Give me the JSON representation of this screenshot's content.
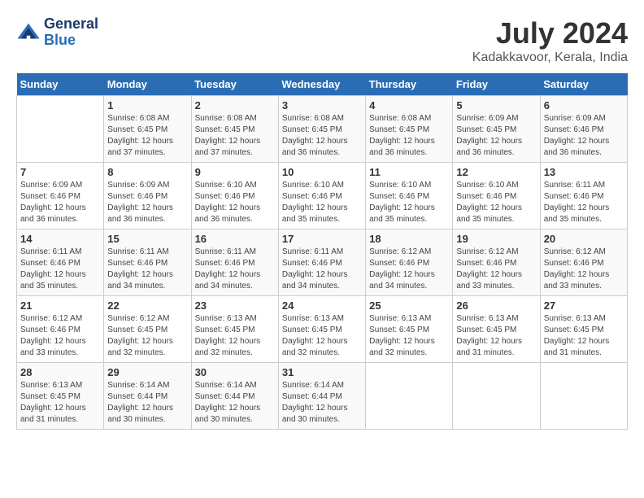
{
  "logo": {
    "line1": "General",
    "line2": "Blue"
  },
  "title": "July 2024",
  "subtitle": "Kadakkavoor, Kerala, India",
  "days_header": [
    "Sunday",
    "Monday",
    "Tuesday",
    "Wednesday",
    "Thursday",
    "Friday",
    "Saturday"
  ],
  "weeks": [
    [
      {
        "day": "",
        "sunrise": "",
        "sunset": "",
        "daylight": ""
      },
      {
        "day": "1",
        "sunrise": "Sunrise: 6:08 AM",
        "sunset": "Sunset: 6:45 PM",
        "daylight": "Daylight: 12 hours and 37 minutes."
      },
      {
        "day": "2",
        "sunrise": "Sunrise: 6:08 AM",
        "sunset": "Sunset: 6:45 PM",
        "daylight": "Daylight: 12 hours and 37 minutes."
      },
      {
        "day": "3",
        "sunrise": "Sunrise: 6:08 AM",
        "sunset": "Sunset: 6:45 PM",
        "daylight": "Daylight: 12 hours and 36 minutes."
      },
      {
        "day": "4",
        "sunrise": "Sunrise: 6:08 AM",
        "sunset": "Sunset: 6:45 PM",
        "daylight": "Daylight: 12 hours and 36 minutes."
      },
      {
        "day": "5",
        "sunrise": "Sunrise: 6:09 AM",
        "sunset": "Sunset: 6:45 PM",
        "daylight": "Daylight: 12 hours and 36 minutes."
      },
      {
        "day": "6",
        "sunrise": "Sunrise: 6:09 AM",
        "sunset": "Sunset: 6:46 PM",
        "daylight": "Daylight: 12 hours and 36 minutes."
      }
    ],
    [
      {
        "day": "7",
        "sunrise": "Sunrise: 6:09 AM",
        "sunset": "Sunset: 6:46 PM",
        "daylight": "Daylight: 12 hours and 36 minutes."
      },
      {
        "day": "8",
        "sunrise": "Sunrise: 6:09 AM",
        "sunset": "Sunset: 6:46 PM",
        "daylight": "Daylight: 12 hours and 36 minutes."
      },
      {
        "day": "9",
        "sunrise": "Sunrise: 6:10 AM",
        "sunset": "Sunset: 6:46 PM",
        "daylight": "Daylight: 12 hours and 36 minutes."
      },
      {
        "day": "10",
        "sunrise": "Sunrise: 6:10 AM",
        "sunset": "Sunset: 6:46 PM",
        "daylight": "Daylight: 12 hours and 35 minutes."
      },
      {
        "day": "11",
        "sunrise": "Sunrise: 6:10 AM",
        "sunset": "Sunset: 6:46 PM",
        "daylight": "Daylight: 12 hours and 35 minutes."
      },
      {
        "day": "12",
        "sunrise": "Sunrise: 6:10 AM",
        "sunset": "Sunset: 6:46 PM",
        "daylight": "Daylight: 12 hours and 35 minutes."
      },
      {
        "day": "13",
        "sunrise": "Sunrise: 6:11 AM",
        "sunset": "Sunset: 6:46 PM",
        "daylight": "Daylight: 12 hours and 35 minutes."
      }
    ],
    [
      {
        "day": "14",
        "sunrise": "Sunrise: 6:11 AM",
        "sunset": "Sunset: 6:46 PM",
        "daylight": "Daylight: 12 hours and 35 minutes."
      },
      {
        "day": "15",
        "sunrise": "Sunrise: 6:11 AM",
        "sunset": "Sunset: 6:46 PM",
        "daylight": "Daylight: 12 hours and 34 minutes."
      },
      {
        "day": "16",
        "sunrise": "Sunrise: 6:11 AM",
        "sunset": "Sunset: 6:46 PM",
        "daylight": "Daylight: 12 hours and 34 minutes."
      },
      {
        "day": "17",
        "sunrise": "Sunrise: 6:11 AM",
        "sunset": "Sunset: 6:46 PM",
        "daylight": "Daylight: 12 hours and 34 minutes."
      },
      {
        "day": "18",
        "sunrise": "Sunrise: 6:12 AM",
        "sunset": "Sunset: 6:46 PM",
        "daylight": "Daylight: 12 hours and 34 minutes."
      },
      {
        "day": "19",
        "sunrise": "Sunrise: 6:12 AM",
        "sunset": "Sunset: 6:46 PM",
        "daylight": "Daylight: 12 hours and 33 minutes."
      },
      {
        "day": "20",
        "sunrise": "Sunrise: 6:12 AM",
        "sunset": "Sunset: 6:46 PM",
        "daylight": "Daylight: 12 hours and 33 minutes."
      }
    ],
    [
      {
        "day": "21",
        "sunrise": "Sunrise: 6:12 AM",
        "sunset": "Sunset: 6:46 PM",
        "daylight": "Daylight: 12 hours and 33 minutes."
      },
      {
        "day": "22",
        "sunrise": "Sunrise: 6:12 AM",
        "sunset": "Sunset: 6:45 PM",
        "daylight": "Daylight: 12 hours and 32 minutes."
      },
      {
        "day": "23",
        "sunrise": "Sunrise: 6:13 AM",
        "sunset": "Sunset: 6:45 PM",
        "daylight": "Daylight: 12 hours and 32 minutes."
      },
      {
        "day": "24",
        "sunrise": "Sunrise: 6:13 AM",
        "sunset": "Sunset: 6:45 PM",
        "daylight": "Daylight: 12 hours and 32 minutes."
      },
      {
        "day": "25",
        "sunrise": "Sunrise: 6:13 AM",
        "sunset": "Sunset: 6:45 PM",
        "daylight": "Daylight: 12 hours and 32 minutes."
      },
      {
        "day": "26",
        "sunrise": "Sunrise: 6:13 AM",
        "sunset": "Sunset: 6:45 PM",
        "daylight": "Daylight: 12 hours and 31 minutes."
      },
      {
        "day": "27",
        "sunrise": "Sunrise: 6:13 AM",
        "sunset": "Sunset: 6:45 PM",
        "daylight": "Daylight: 12 hours and 31 minutes."
      }
    ],
    [
      {
        "day": "28",
        "sunrise": "Sunrise: 6:13 AM",
        "sunset": "Sunset: 6:45 PM",
        "daylight": "Daylight: 12 hours and 31 minutes."
      },
      {
        "day": "29",
        "sunrise": "Sunrise: 6:14 AM",
        "sunset": "Sunset: 6:44 PM",
        "daylight": "Daylight: 12 hours and 30 minutes."
      },
      {
        "day": "30",
        "sunrise": "Sunrise: 6:14 AM",
        "sunset": "Sunset: 6:44 PM",
        "daylight": "Daylight: 12 hours and 30 minutes."
      },
      {
        "day": "31",
        "sunrise": "Sunrise: 6:14 AM",
        "sunset": "Sunset: 6:44 PM",
        "daylight": "Daylight: 12 hours and 30 minutes."
      },
      {
        "day": "",
        "sunrise": "",
        "sunset": "",
        "daylight": ""
      },
      {
        "day": "",
        "sunrise": "",
        "sunset": "",
        "daylight": ""
      },
      {
        "day": "",
        "sunrise": "",
        "sunset": "",
        "daylight": ""
      }
    ]
  ]
}
